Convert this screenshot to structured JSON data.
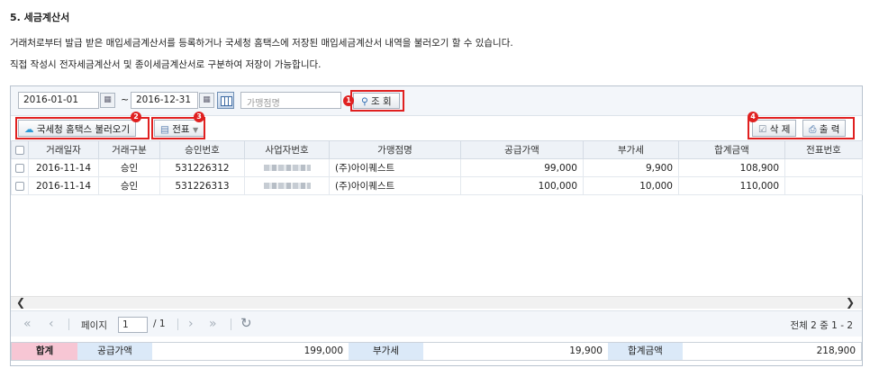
{
  "doc": {
    "title": "5. 세금계산서",
    "line1": "거래처로부터 발급 받은 매입세금계산서를 등록하거나 국세청 홈택스에 저장된 매입세금계산서 내역을 불러오기 할 수 있습니다.",
    "line2": "직접 작성시 전자세금계산서 및 종이세금계산서로 구분하여 저장이 가능합니다."
  },
  "search": {
    "date_from": "2016-01-01",
    "tilde": "~",
    "date_to": "2016-12-31",
    "store_placeholder": "가맹점명",
    "search_label": "조 회"
  },
  "toolbar": {
    "import_label": "국세청 홈택스 불러오기",
    "voucher_label": "전표",
    "delete_label": "삭 제",
    "print_label": "출 력"
  },
  "badges": [
    "1",
    "2",
    "3",
    "4"
  ],
  "table": {
    "columns": [
      "",
      "거래일자",
      "거래구분",
      "승인번호",
      "사업자번호",
      "가맹점명",
      "공급가액",
      "부가세",
      "합계금액",
      "전표번호"
    ],
    "rows": [
      {
        "date": "2016-11-14",
        "type": "승인",
        "approval": "531226312",
        "store": "(주)아이퀘스트",
        "supply": "99,000",
        "vat": "9,900",
        "total": "108,900",
        "voucher": ""
      },
      {
        "date": "2016-11-14",
        "type": "승인",
        "approval": "531226313",
        "store": "(주)아이퀘스트",
        "supply": "100,000",
        "vat": "10,000",
        "total": "110,000",
        "voucher": ""
      }
    ]
  },
  "pager": {
    "page_label": "페이지",
    "page_value": "1",
    "page_of": "/ 1",
    "summary": "전체 2 중 1 - 2"
  },
  "totals": {
    "label": "합계",
    "supply_label": "공급가액",
    "supply_value": "199,000",
    "vat_label": "부가세",
    "vat_value": "19,900",
    "total_label": "합계금액",
    "total_value": "218,900"
  },
  "colors": {
    "accent_red": "#e02020",
    "total_label_bg": "#f7c6d4",
    "field_label_bg": "#dbe9f8"
  },
  "icons": [
    "calendar-icon",
    "grid-view-icon",
    "search-icon",
    "hometax-icon",
    "voucher-icon",
    "chevron-down-icon",
    "trash-icon",
    "printer-icon",
    "first-page-icon",
    "prev-page-icon",
    "next-page-icon",
    "last-page-icon",
    "refresh-icon",
    "scroll-left-icon",
    "scroll-right-icon"
  ]
}
